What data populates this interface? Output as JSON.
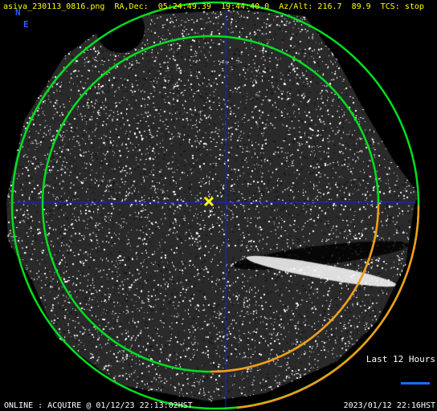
{
  "header": {
    "filename": "asiva_230113_0816.png",
    "radec_label": "RA,Dec:",
    "ra": "05:24:49.39",
    "dec": "19:44:40.0",
    "azalt_label": "Az/Alt:",
    "az": "216.7",
    "alt": "89.9",
    "tcs_label": "TCS:",
    "tcs_state": "stop"
  },
  "compass": {
    "north": "N",
    "east": "E"
  },
  "legend": {
    "label": "Last 12 Hours"
  },
  "footer": {
    "status": "ONLINE : ACQUIRE @ 01/12/23 22:13:02HST",
    "timestamp": "2023/01/12 22:16HST"
  },
  "colors": {
    "header_text": "#ffff00",
    "compass": "#2a5cff",
    "crosshair": "#1a1aff",
    "horizon_circle": "#00e020",
    "track_arc": "#ff9a1a",
    "target_marker": "#ffff00",
    "legend_line": "#1e6bff"
  }
}
